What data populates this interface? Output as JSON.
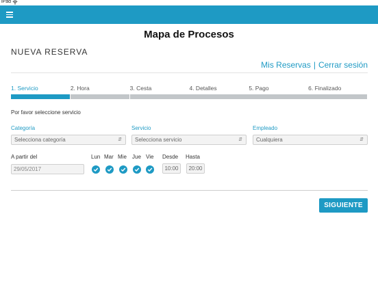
{
  "status_bar": {
    "device": "iPad"
  },
  "header": {
    "title": "Mapa de Procesos"
  },
  "section": {
    "title": "NUEVA RESERVA"
  },
  "links": {
    "my_reservations": "Mis Reservas",
    "separator": "|",
    "logout": "Cerrar sesión"
  },
  "steps": [
    {
      "label": "1. Servicio",
      "active": true
    },
    {
      "label": "2. Hora",
      "active": false
    },
    {
      "label": "3. Cesta",
      "active": false
    },
    {
      "label": "4. Detalles",
      "active": false
    },
    {
      "label": "5. Pago",
      "active": false
    },
    {
      "label": "6. Finalizado",
      "active": false
    }
  ],
  "instruction": "Por favor seleccione servicio",
  "filters": {
    "category": {
      "label": "Categoría",
      "value": "Selecciona categoría"
    },
    "service": {
      "label": "Servicio",
      "value": "Selecciona servicio"
    },
    "employee": {
      "label": "Empleado",
      "value": "Cualquiera"
    }
  },
  "schedule": {
    "from_label": "A partir del",
    "date": "29/05/2017",
    "days": [
      {
        "label": "Lun",
        "checked": true
      },
      {
        "label": "Mar",
        "checked": true
      },
      {
        "label": "Mie",
        "checked": true
      },
      {
        "label": "Jue",
        "checked": true
      },
      {
        "label": "Vie",
        "checked": true
      }
    ],
    "start_label": "Desde",
    "start_time": "10:00",
    "end_label": "Hasta",
    "end_time": "20:00"
  },
  "actions": {
    "next": "SIGUIENTE"
  },
  "colors": {
    "accent": "#1e9ac4",
    "step_inactive": "#c2c6c9"
  }
}
